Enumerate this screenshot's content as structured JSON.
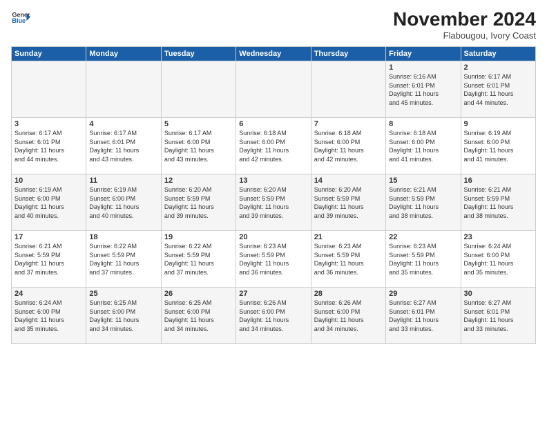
{
  "logo": {
    "general": "General",
    "blue": "Blue"
  },
  "header": {
    "month": "November 2024",
    "location": "Flabougou, Ivory Coast"
  },
  "weekdays": [
    "Sunday",
    "Monday",
    "Tuesday",
    "Wednesday",
    "Thursday",
    "Friday",
    "Saturday"
  ],
  "weeks": [
    [
      {
        "day": "",
        "info": ""
      },
      {
        "day": "",
        "info": ""
      },
      {
        "day": "",
        "info": ""
      },
      {
        "day": "",
        "info": ""
      },
      {
        "day": "",
        "info": ""
      },
      {
        "day": "1",
        "info": "Sunrise: 6:16 AM\nSunset: 6:01 PM\nDaylight: 11 hours\nand 45 minutes."
      },
      {
        "day": "2",
        "info": "Sunrise: 6:17 AM\nSunset: 6:01 PM\nDaylight: 11 hours\nand 44 minutes."
      }
    ],
    [
      {
        "day": "3",
        "info": "Sunrise: 6:17 AM\nSunset: 6:01 PM\nDaylight: 11 hours\nand 44 minutes."
      },
      {
        "day": "4",
        "info": "Sunrise: 6:17 AM\nSunset: 6:01 PM\nDaylight: 11 hours\nand 43 minutes."
      },
      {
        "day": "5",
        "info": "Sunrise: 6:17 AM\nSunset: 6:00 PM\nDaylight: 11 hours\nand 43 minutes."
      },
      {
        "day": "6",
        "info": "Sunrise: 6:18 AM\nSunset: 6:00 PM\nDaylight: 11 hours\nand 42 minutes."
      },
      {
        "day": "7",
        "info": "Sunrise: 6:18 AM\nSunset: 6:00 PM\nDaylight: 11 hours\nand 42 minutes."
      },
      {
        "day": "8",
        "info": "Sunrise: 6:18 AM\nSunset: 6:00 PM\nDaylight: 11 hours\nand 41 minutes."
      },
      {
        "day": "9",
        "info": "Sunrise: 6:19 AM\nSunset: 6:00 PM\nDaylight: 11 hours\nand 41 minutes."
      }
    ],
    [
      {
        "day": "10",
        "info": "Sunrise: 6:19 AM\nSunset: 6:00 PM\nDaylight: 11 hours\nand 40 minutes."
      },
      {
        "day": "11",
        "info": "Sunrise: 6:19 AM\nSunset: 6:00 PM\nDaylight: 11 hours\nand 40 minutes."
      },
      {
        "day": "12",
        "info": "Sunrise: 6:20 AM\nSunset: 5:59 PM\nDaylight: 11 hours\nand 39 minutes."
      },
      {
        "day": "13",
        "info": "Sunrise: 6:20 AM\nSunset: 5:59 PM\nDaylight: 11 hours\nand 39 minutes."
      },
      {
        "day": "14",
        "info": "Sunrise: 6:20 AM\nSunset: 5:59 PM\nDaylight: 11 hours\nand 39 minutes."
      },
      {
        "day": "15",
        "info": "Sunrise: 6:21 AM\nSunset: 5:59 PM\nDaylight: 11 hours\nand 38 minutes."
      },
      {
        "day": "16",
        "info": "Sunrise: 6:21 AM\nSunset: 5:59 PM\nDaylight: 11 hours\nand 38 minutes."
      }
    ],
    [
      {
        "day": "17",
        "info": "Sunrise: 6:21 AM\nSunset: 5:59 PM\nDaylight: 11 hours\nand 37 minutes."
      },
      {
        "day": "18",
        "info": "Sunrise: 6:22 AM\nSunset: 5:59 PM\nDaylight: 11 hours\nand 37 minutes."
      },
      {
        "day": "19",
        "info": "Sunrise: 6:22 AM\nSunset: 5:59 PM\nDaylight: 11 hours\nand 37 minutes."
      },
      {
        "day": "20",
        "info": "Sunrise: 6:23 AM\nSunset: 5:59 PM\nDaylight: 11 hours\nand 36 minutes."
      },
      {
        "day": "21",
        "info": "Sunrise: 6:23 AM\nSunset: 5:59 PM\nDaylight: 11 hours\nand 36 minutes."
      },
      {
        "day": "22",
        "info": "Sunrise: 6:23 AM\nSunset: 5:59 PM\nDaylight: 11 hours\nand 35 minutes."
      },
      {
        "day": "23",
        "info": "Sunrise: 6:24 AM\nSunset: 6:00 PM\nDaylight: 11 hours\nand 35 minutes."
      }
    ],
    [
      {
        "day": "24",
        "info": "Sunrise: 6:24 AM\nSunset: 6:00 PM\nDaylight: 11 hours\nand 35 minutes."
      },
      {
        "day": "25",
        "info": "Sunrise: 6:25 AM\nSunset: 6:00 PM\nDaylight: 11 hours\nand 34 minutes."
      },
      {
        "day": "26",
        "info": "Sunrise: 6:25 AM\nSunset: 6:00 PM\nDaylight: 11 hours\nand 34 minutes."
      },
      {
        "day": "27",
        "info": "Sunrise: 6:26 AM\nSunset: 6:00 PM\nDaylight: 11 hours\nand 34 minutes."
      },
      {
        "day": "28",
        "info": "Sunrise: 6:26 AM\nSunset: 6:00 PM\nDaylight: 11 hours\nand 34 minutes."
      },
      {
        "day": "29",
        "info": "Sunrise: 6:27 AM\nSunset: 6:01 PM\nDaylight: 11 hours\nand 33 minutes."
      },
      {
        "day": "30",
        "info": "Sunrise: 6:27 AM\nSunset: 6:01 PM\nDaylight: 11 hours\nand 33 minutes."
      }
    ]
  ]
}
